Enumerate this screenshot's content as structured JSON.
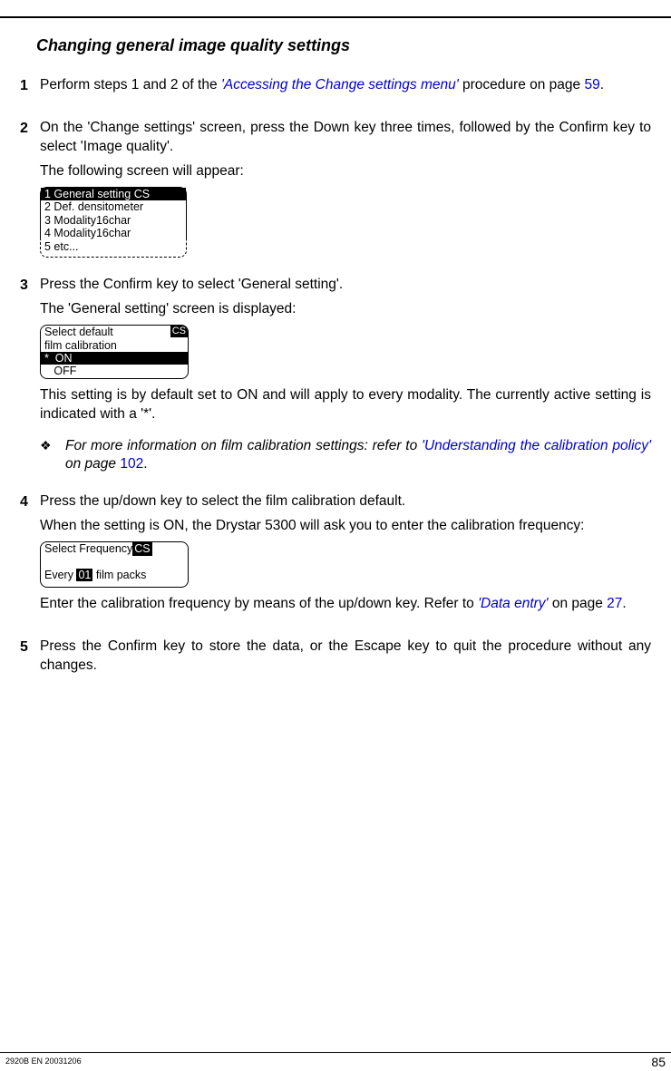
{
  "title": "Changing general image quality settings",
  "step1": {
    "num": "1",
    "text_a": "Perform steps 1 and 2 of the ",
    "link": "'Accessing the Change settings menu'",
    "text_b": " procedure on page ",
    "page": "59",
    "text_c": "."
  },
  "step2": {
    "num": "2",
    "p1": "On the 'Change settings' screen, press the Down key three times, followed by the Confirm key to select 'Image quality'.",
    "p2": "The following screen will appear:",
    "lcd": {
      "r1": "1 General setting",
      "tag": "CS",
      "r2": "2 Def. densitometer",
      "r3": "3 Modality16char",
      "r4": "4 Modality16char",
      "r5": "5 etc..."
    }
  },
  "step3": {
    "num": "3",
    "p1": "Press the Confirm key to select 'General setting'.",
    "p2": "The 'General setting' screen is displayed:",
    "lcd": {
      "r1": "Select default",
      "tag": "CS",
      "r2": "film calibration",
      "r3": "*  ON",
      "r4": "   OFF"
    },
    "p3": "This setting is by default set to ON and will apply to every modality. The currently active setting is indicated with a '*'.",
    "note_a": "For more information on film calibration settings: refer to ",
    "note_link": "'Understanding the calibration policy'",
    "note_b": " on page ",
    "note_page": "102",
    "note_c": "."
  },
  "step4": {
    "num": "4",
    "p1": "Press the up/down key to select the film calibration default.",
    "p2": "When the setting is ON, the Drystar 5300 will ask you to enter the calibration frequency:",
    "lcd": {
      "r1": "Select Frequency",
      "tag": "CS",
      "r3a": "Every",
      "r3b": "01",
      "r3c": " film packs"
    },
    "p3a": "Enter the calibration frequency by means of the up/down key. Refer to ",
    "p3link": "'Data entry'",
    "p3b": " on page ",
    "p3page": "27",
    "p3c": "."
  },
  "step5": {
    "num": "5",
    "p1": "Press the Confirm key to store the data, or the Escape key to quit the procedure without any changes."
  },
  "footer": {
    "left": "2920B EN 20031206",
    "right": "85"
  },
  "note_symbol": "❖"
}
